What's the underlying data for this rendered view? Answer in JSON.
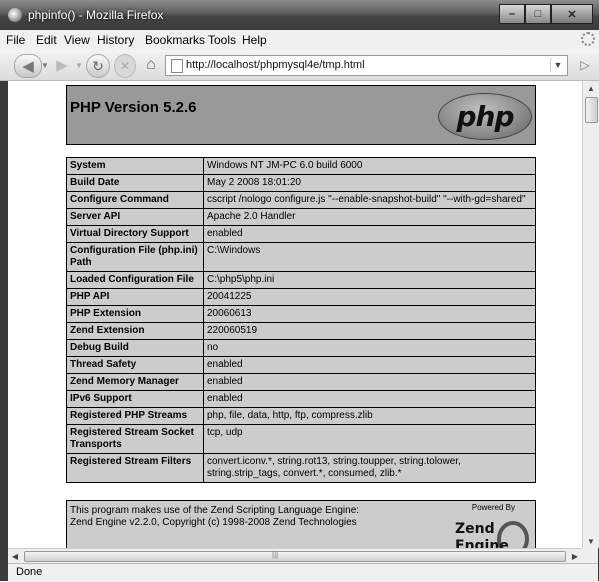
{
  "window": {
    "title": "phpinfo() - Mozilla Firefox"
  },
  "menu": {
    "items": [
      "File",
      "Edit",
      "View",
      "History",
      "Bookmarks",
      "Tools",
      "Help"
    ]
  },
  "navigation": {
    "url": "http://localhost/phpmysql4e/tmp.html"
  },
  "page": {
    "header": {
      "version": "PHP Version 5.2.6",
      "logo_text": "php"
    },
    "rows": [
      {
        "label": "System",
        "value": "Windows NT JM-PC 6.0 build 6000"
      },
      {
        "label": "Build Date",
        "value": "May 2 2008 18:01:20"
      },
      {
        "label": "Configure Command",
        "value": "cscript /nologo configure.js \"--enable-snapshot-build\" \"--with-gd=shared\""
      },
      {
        "label": "Server API",
        "value": "Apache 2.0 Handler"
      },
      {
        "label": "Virtual Directory Support",
        "value": "enabled"
      },
      {
        "label": "Configuration File (php.ini) Path",
        "value": "C:\\Windows"
      },
      {
        "label": "Loaded Configuration File",
        "value": "C:\\php5\\php.ini"
      },
      {
        "label": "PHP API",
        "value": "20041225"
      },
      {
        "label": "PHP Extension",
        "value": "20060613"
      },
      {
        "label": "Zend Extension",
        "value": "220060519"
      },
      {
        "label": "Debug Build",
        "value": "no"
      },
      {
        "label": "Thread Safety",
        "value": "enabled"
      },
      {
        "label": "Zend Memory Manager",
        "value": "enabled"
      },
      {
        "label": "IPv6 Support",
        "value": "enabled"
      },
      {
        "label": "Registered PHP Streams",
        "value": "php, file, data, http, ftp, compress.zlib"
      },
      {
        "label": "Registered Stream Socket Transports",
        "value": "tcp, udp"
      },
      {
        "label": "Registered Stream Filters",
        "value": "convert.iconv.*, string.rot13, string.toupper, string.tolower, string.strip_tags, convert.*, consumed, zlib.*"
      }
    ],
    "zend": {
      "line1": "This program makes use of the Zend Scripting Language Engine:",
      "line2": "Zend Engine v2.2.0, Copyright (c) 1998-2008 Zend Technologies",
      "powered_by": "Powered By",
      "logo_line1": "Zend",
      "logo_line2": "Engine"
    }
  },
  "status": {
    "text": "Done"
  },
  "icons": [
    "firefox-icon",
    "back-arrow-icon",
    "forward-arrow-icon",
    "reload-icon",
    "stop-icon",
    "home-icon",
    "page-favicon",
    "go-arrow-icon",
    "throbber-icon"
  ]
}
